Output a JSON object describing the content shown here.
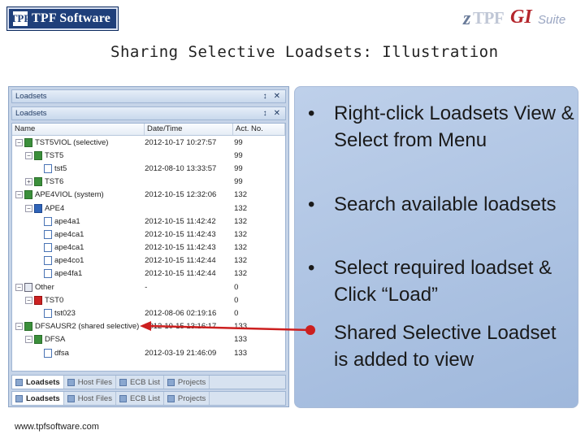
{
  "header": {
    "left_logo_mark": "TPF",
    "left_logo_text": "TPF Software",
    "right_logo_z": "z",
    "right_logo_tpf": "TPF",
    "right_logo_gi": "GI",
    "right_logo_suite": "Suite"
  },
  "title": "Sharing Selective Loadsets: Illustration",
  "outer_pane": {
    "title": "Loadsets",
    "pin_icon": "pin-icon",
    "close_icon": "close-icon"
  },
  "inner_pane": {
    "title": "Loadsets",
    "pin_icon": "pin-icon",
    "close_icon": "close-icon"
  },
  "columns": [
    "Name",
    "Date/Time",
    "Act. No."
  ],
  "rows": [
    {
      "indent": 0,
      "toggle": "−",
      "icon": "set",
      "name": "TST5VIOL (selective)",
      "date": "2012-10-17 10:27:57",
      "act": "99"
    },
    {
      "indent": 1,
      "toggle": "−",
      "icon": "set",
      "name": "TST5",
      "date": "",
      "act": "99"
    },
    {
      "indent": 2,
      "toggle": "",
      "icon": "doc",
      "name": "tst5",
      "date": "2012-08-10 13:33:57",
      "act": "99"
    },
    {
      "indent": 1,
      "toggle": "+",
      "icon": "set",
      "name": "TST6",
      "date": "",
      "act": "99"
    },
    {
      "indent": 0,
      "toggle": "−",
      "icon": "set",
      "name": "APE4VIOL (system)",
      "date": "2012-10-15 12:32:06",
      "act": "132"
    },
    {
      "indent": 1,
      "toggle": "−",
      "icon": "blue",
      "name": "APE4",
      "date": "",
      "act": "132"
    },
    {
      "indent": 2,
      "toggle": "",
      "icon": "doc",
      "name": "ape4a1",
      "date": "2012-10-15 11:42:42",
      "act": "132"
    },
    {
      "indent": 2,
      "toggle": "",
      "icon": "doc",
      "name": "ape4ca1",
      "date": "2012-10-15 11:42:43",
      "act": "132"
    },
    {
      "indent": 2,
      "toggle": "",
      "icon": "doc",
      "name": "ape4ca1",
      "date": "2012-10-15 11:42:43",
      "act": "132"
    },
    {
      "indent": 2,
      "toggle": "",
      "icon": "doc",
      "name": "ape4co1",
      "date": "2012-10-15 11:42:44",
      "act": "132"
    },
    {
      "indent": 2,
      "toggle": "",
      "icon": "doc",
      "name": "ape4fa1",
      "date": "2012-10-15 11:42:44",
      "act": "132"
    },
    {
      "indent": 0,
      "toggle": "−",
      "icon": "fold",
      "name": "Other",
      "date": "-",
      "act": "0"
    },
    {
      "indent": 1,
      "toggle": "−",
      "icon": "red",
      "name": "TST0",
      "date": "",
      "act": "0"
    },
    {
      "indent": 2,
      "toggle": "",
      "icon": "doc",
      "name": "tst023",
      "date": "2012-08-06 02:19:16",
      "act": "0"
    },
    {
      "indent": 0,
      "toggle": "−",
      "icon": "set",
      "name": "DFSAUSR2 (shared selective)",
      "date": "2012-10-15 13:16:17",
      "act": "133"
    },
    {
      "indent": 1,
      "toggle": "−",
      "icon": "set",
      "name": "DFSA",
      "date": "",
      "act": "133"
    },
    {
      "indent": 2,
      "toggle": "",
      "icon": "doc",
      "name": "dfsa",
      "date": "2012-03-19 21:46:09",
      "act": "133"
    }
  ],
  "tabs": [
    "Loadsets",
    "Host Files",
    "ECB List",
    "Projects"
  ],
  "bullets": [
    {
      "marker": "•",
      "text": "Right-click Loadsets View & Select from Menu"
    },
    {
      "marker": "•",
      "text": "Search available loadsets"
    },
    {
      "marker": "•",
      "text": "Select required loadset & Click “Load”"
    },
    {
      "marker": "",
      "text": "Shared Selective Loadset is added to view"
    }
  ],
  "footer": "www.tpfsoftware.com",
  "colors": {
    "arrow": "#cc1f1f",
    "panel": "#b3c6e4",
    "logo_bg": "#1f3f7a"
  }
}
